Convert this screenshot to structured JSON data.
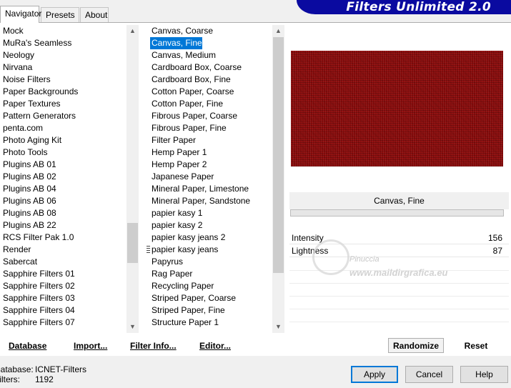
{
  "app": {
    "title": "Filters Unlimited 2.0"
  },
  "tabs": [
    {
      "label": "Navigator",
      "active": true
    },
    {
      "label": "Presets",
      "active": false
    },
    {
      "label": "About",
      "active": false
    }
  ],
  "categories": {
    "items": [
      "Mock",
      "MuRa's Seamless",
      "Neology",
      "Nirvana",
      "Noise Filters",
      "Paper Backgrounds",
      "Paper Textures",
      "Pattern Generators",
      "penta.com",
      "Photo Aging Kit",
      "Photo Tools",
      "Plugins AB 01",
      "Plugins AB 02",
      "Plugins AB 04",
      "Plugins AB 06",
      "Plugins AB 08",
      "Plugins AB 22",
      "RCS Filter Pak 1.0",
      "Render",
      "Sabercat",
      "Sapphire Filters 01",
      "Sapphire Filters 02",
      "Sapphire Filters 03",
      "Sapphire Filters 04",
      "Sapphire Filters 07"
    ],
    "scroll_position": 0.7
  },
  "filters": {
    "items": [
      "Canvas, Coarse",
      "Canvas, Fine",
      "Canvas, Medium",
      "Cardboard Box, Coarse",
      "Cardboard Box, Fine",
      "Cotton Paper, Coarse",
      "Cotton Paper, Fine",
      "Fibrous Paper, Coarse",
      "Fibrous Paper, Fine",
      "Filter Paper",
      "Hemp Paper 1",
      "Hemp Paper 2",
      "Japanese Paper",
      "Mineral Paper, Limestone",
      "Mineral Paper, Sandstone",
      "papier kasy 1",
      "papier kasy 2",
      "papier kasy jeans 2",
      "papier kasy jeans",
      "Papyrus",
      "Rag Paper",
      "Recycling Paper",
      "Striped Paper, Coarse",
      "Striped Paper, Fine",
      "Structure Paper 1"
    ],
    "selected": "Canvas, Fine",
    "marked": "papier kasy jeans"
  },
  "preview": {
    "filter_name": "Canvas, Fine",
    "texture_color": "#8c0c0c"
  },
  "params": [
    {
      "name": "Intensity",
      "value": "156"
    },
    {
      "name": "Lightness",
      "value": "87"
    }
  ],
  "watermark": {
    "name": "Pinuccia",
    "url": "www.maildirgrafica.eu"
  },
  "buttons": {
    "database": "Database",
    "import": "Import...",
    "filter_info": "Filter Info...",
    "editor": "Editor...",
    "randomize": "Randomize",
    "reset": "Reset",
    "apply": "Apply",
    "cancel": "Cancel",
    "help": "Help"
  },
  "status": {
    "database_label": "Database:",
    "database_value": "ICNET-Filters",
    "filters_label": "Filters:",
    "filters_value": "1192"
  },
  "colors": {
    "accent": "#0078d7",
    "banner": "#0a0aa0"
  }
}
